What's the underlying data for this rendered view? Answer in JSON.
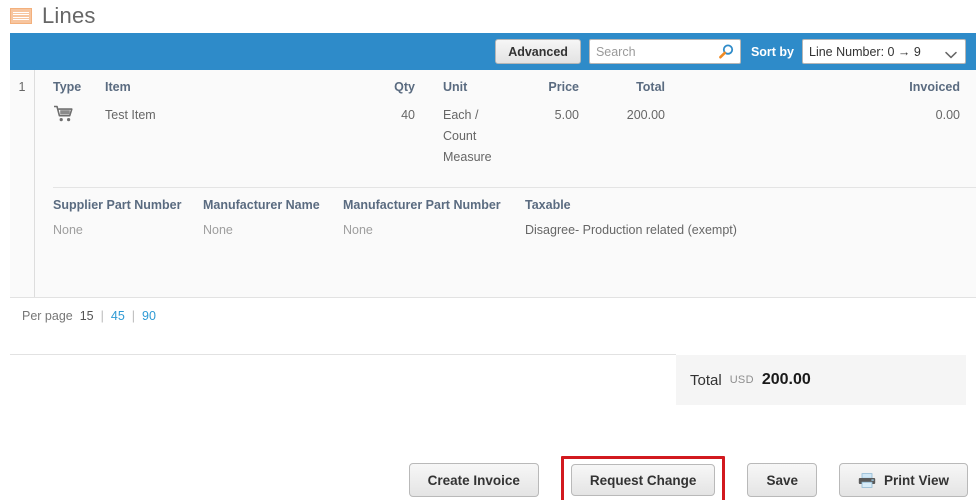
{
  "header": {
    "title": "Lines",
    "icon": "lines-icon"
  },
  "toolbar": {
    "advanced_label": "Advanced",
    "search_placeholder": "Search",
    "search_value": "",
    "search_icon": "search-icon",
    "sort_by_label": "Sort by",
    "sort_selected": "Line Number: 0 → 9",
    "sort_chevron_icon": "chevron-down-icon"
  },
  "line_item": {
    "number": "1",
    "top_columns": [
      {
        "header": "Type",
        "value": "",
        "icon": "shopping-cart-icon"
      },
      {
        "header": "Item",
        "value": "Test Item"
      },
      {
        "header": "Qty",
        "value": "40"
      },
      {
        "header": "Unit",
        "value": "Each / Count Measure"
      },
      {
        "header": "Price",
        "value": "5.00"
      },
      {
        "header": "Total",
        "value": "200.00"
      },
      {
        "header": "Invoiced",
        "value": "0.00",
        "is_link": true
      }
    ],
    "bottom_columns": [
      {
        "header": "Supplier Part Number",
        "value": "None"
      },
      {
        "header": "Manufacturer Name",
        "value": "None"
      },
      {
        "header": "Manufacturer Part Number",
        "value": "None"
      },
      {
        "header": "Taxable",
        "value": "Disagree- Production related (exempt)"
      }
    ]
  },
  "pagination": {
    "label": "Per page",
    "current": "15",
    "separator": "|",
    "option_45": "45",
    "option_90": "90"
  },
  "total": {
    "label": "Total",
    "currency": "USD",
    "amount": "200.00"
  },
  "footer": {
    "create_invoice": "Create Invoice",
    "request_change": "Request Change",
    "save": "Save",
    "print_view": "Print View",
    "print_icon": "printer-icon",
    "highlight_color": "#d2191f"
  },
  "colors": {
    "toolbar_blue": "#2e8bc9",
    "link_blue": "#2e9ad4",
    "header_text": "#5a6b80",
    "panel_bg": "#fafafa",
    "highlight_red": "#d2191f"
  }
}
